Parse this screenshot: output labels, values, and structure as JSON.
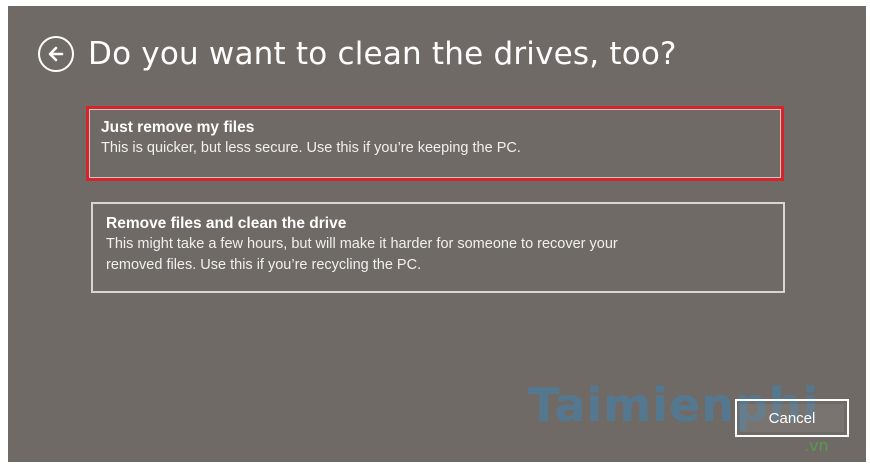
{
  "dialog": {
    "title": "Do you want to clean the drives, too?",
    "back_icon": "arrow-left-circle-icon",
    "colors": {
      "background": "#6f6a66",
      "text": "#ffffff",
      "selected_border": "#d8232a"
    }
  },
  "options": [
    {
      "title": "Just remove my files",
      "description": "This is quicker, but less secure. Use this if you’re keeping the PC.",
      "selected": true
    },
    {
      "title": "Remove files and clean the drive",
      "description_line1": "This might take a few hours, but will make it harder for someone to recover your",
      "description_line2": "removed files. Use this if you’re recycling the PC.",
      "selected": false
    }
  ],
  "footer": {
    "cancel_label": "Cancel"
  },
  "watermark": {
    "text": "Taimienphi",
    "suffix": ".vn"
  }
}
